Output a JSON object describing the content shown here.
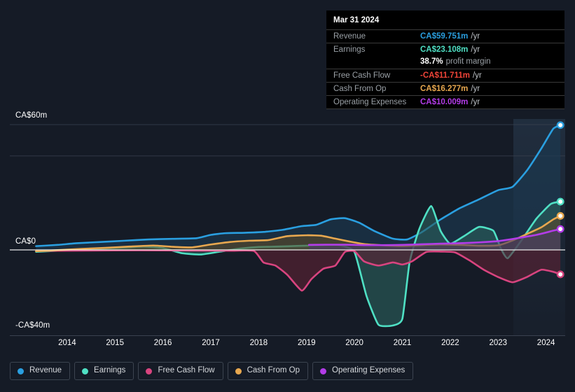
{
  "chart_data": {
    "type": "area",
    "title": "",
    "currency": "CA$",
    "unit": "m",
    "xlabel": "",
    "ylabel": "",
    "ylim": [
      -40,
      60
    ],
    "xlim": [
      2013.3,
      2024.4
    ],
    "grid": true,
    "legend_position": "bottom-left",
    "y_ticks": [
      {
        "value": 60,
        "label": "CA$60m"
      },
      {
        "value": 0,
        "label": "CA$0"
      },
      {
        "value": -40,
        "label": "-CA$40m"
      }
    ],
    "x_ticks": [
      {
        "value": 2014,
        "label": "2014"
      },
      {
        "value": 2015,
        "label": "2015"
      },
      {
        "value": 2016,
        "label": "2016"
      },
      {
        "value": 2017,
        "label": "2017"
      },
      {
        "value": 2018,
        "label": "2018"
      },
      {
        "value": 2019,
        "label": "2019"
      },
      {
        "value": 2020,
        "label": "2020"
      },
      {
        "value": 2021,
        "label": "2021"
      },
      {
        "value": 2022,
        "label": "2022"
      },
      {
        "value": 2023,
        "label": "2023"
      },
      {
        "value": 2024,
        "label": "2024"
      }
    ],
    "forecast_start": 2023.1,
    "series": [
      {
        "name": "Revenue",
        "color": "#2a9fe0",
        "fill": "#1b3a52",
        "x": [
          2013.35,
          2013.8,
          2014.2,
          2014.7,
          2015.2,
          2015.7,
          2016.2,
          2016.7,
          2017.0,
          2017.3,
          2017.7,
          2018.1,
          2018.5,
          2018.9,
          2019.2,
          2019.5,
          2019.8,
          2020.1,
          2020.4,
          2020.8,
          2021.1,
          2021.4,
          2021.8,
          2022.2,
          2022.6,
          2023.0,
          2023.3,
          2023.6,
          2023.9,
          2024.15,
          2024.3
        ],
        "values": [
          1.8,
          2.4,
          3.2,
          3.8,
          4.4,
          5.0,
          5.3,
          5.6,
          7.2,
          8.0,
          8.2,
          8.6,
          9.6,
          11.4,
          12.0,
          14.6,
          15.2,
          13.0,
          9.2,
          5.4,
          5.0,
          8.4,
          14.6,
          20.0,
          24.2,
          28.6,
          30.2,
          38.0,
          48.5,
          58.0,
          59.751
        ]
      },
      {
        "name": "Earnings",
        "color": "#4fe0c4",
        "fill": "#2a5f5c",
        "x": [
          2013.35,
          2013.8,
          2014.2,
          2014.7,
          2015.2,
          2015.6,
          2016.0,
          2016.4,
          2016.8,
          2017.2,
          2017.6,
          2018.0,
          2018.4,
          2018.8,
          2019.1,
          2019.4,
          2019.7,
          2020.0,
          2020.25,
          2020.5,
          2020.8,
          2021.0,
          2021.15,
          2021.35,
          2021.6,
          2021.8,
          2022.0,
          2022.3,
          2022.6,
          2022.9,
          2023.05,
          2023.2,
          2023.5,
          2023.8,
          2024.1,
          2024.3
        ],
        "values": [
          -0.9,
          -0.4,
          0.2,
          0.6,
          1.1,
          1.6,
          0.9,
          -1.6,
          -2.2,
          -0.8,
          0.6,
          1.4,
          1.6,
          1.9,
          2.1,
          2.3,
          2.2,
          -1.0,
          -22.0,
          -35.8,
          -36.2,
          -33.0,
          -6.0,
          9.8,
          21.0,
          9.0,
          3.0,
          6.8,
          11.0,
          9.2,
          1.0,
          -4.0,
          5.0,
          15.0,
          22.0,
          23.108
        ]
      },
      {
        "name": "Free Cash Flow",
        "color": "#d8447f",
        "fill": "#5c2233",
        "x": [
          2013.35,
          2014.5,
          2015.5,
          2016.5,
          2017.4,
          2017.9,
          2018.1,
          2018.35,
          2018.6,
          2018.9,
          2019.1,
          2019.35,
          2019.6,
          2019.8,
          2020.0,
          2020.2,
          2020.5,
          2020.8,
          2021.0,
          2021.2,
          2021.5,
          2021.8,
          2022.1,
          2022.4,
          2022.7,
          2023.0,
          2023.3,
          2023.6,
          2023.9,
          2024.15,
          2024.3
        ],
        "values": [
          -0.5,
          -0.3,
          -0.2,
          -0.3,
          -0.4,
          -0.5,
          -6.0,
          -7.5,
          -12.0,
          -19.5,
          -14.0,
          -9.0,
          -7.5,
          -1.0,
          -0.6,
          -5.5,
          -7.5,
          -6.0,
          -7.0,
          -5.5,
          -1.0,
          -0.8,
          -1.2,
          -5.0,
          -9.5,
          -13.0,
          -15.5,
          -13.0,
          -9.5,
          -10.5,
          -11.711
        ]
      },
      {
        "name": "Cash From Op",
        "color": "#e8a84f",
        "fill": "#5a4a2a",
        "x": [
          2013.35,
          2013.8,
          2014.3,
          2014.8,
          2015.3,
          2015.8,
          2016.2,
          2016.6,
          2017.0,
          2017.4,
          2017.8,
          2018.2,
          2018.6,
          2019.0,
          2019.3,
          2019.6,
          2019.9,
          2020.2,
          2020.6,
          2021.0,
          2021.4,
          2021.8,
          2022.2,
          2022.6,
          2023.0,
          2023.3,
          2023.6,
          2023.9,
          2024.15,
          2024.3
        ],
        "values": [
          -0.6,
          -0.1,
          0.5,
          1.0,
          1.6,
          2.1,
          1.5,
          1.2,
          2.6,
          3.8,
          4.4,
          4.7,
          6.6,
          7.0,
          6.8,
          5.4,
          4.0,
          2.8,
          2.2,
          1.9,
          2.3,
          2.6,
          2.4,
          2.0,
          2.2,
          4.5,
          7.6,
          10.8,
          14.6,
          16.277
        ]
      },
      {
        "name": "Operating Expenses",
        "color": "#b33ce8",
        "fill": "#4a3a66",
        "x": [
          2019.05,
          2019.4,
          2019.8,
          2020.2,
          2020.6,
          2021.0,
          2021.4,
          2021.8,
          2022.2,
          2022.6,
          2023.0,
          2023.4,
          2023.8,
          2024.15,
          2024.3
        ],
        "values": [
          2.4,
          2.5,
          2.5,
          2.3,
          2.3,
          2.4,
          2.7,
          3.0,
          3.2,
          3.6,
          4.2,
          5.6,
          7.2,
          9.2,
          10.009
        ]
      }
    ]
  },
  "tooltip": {
    "date": "Mar 31 2024",
    "unit_suffix": "/yr",
    "rows": [
      {
        "label": "Revenue",
        "value": "CA$59.751m",
        "color": "#2a9fe0"
      },
      {
        "label": "Earnings",
        "value": "CA$23.108m",
        "color": "#4fe0c4"
      },
      {
        "label": "Free Cash Flow",
        "value": "-CA$11.711m",
        "color": "#f04438"
      },
      {
        "label": "Cash From Op",
        "value": "CA$16.277m",
        "color": "#e8a84f"
      },
      {
        "label": "Operating Expenses",
        "value": "CA$10.009m",
        "color": "#b33ce8"
      }
    ],
    "profit_margin": {
      "value": "38.7%",
      "label": "profit margin"
    }
  },
  "legend": {
    "items": [
      {
        "label": "Revenue",
        "color": "#2a9fe0"
      },
      {
        "label": "Earnings",
        "color": "#4fe0c4"
      },
      {
        "label": "Free Cash Flow",
        "color": "#d8447f"
      },
      {
        "label": "Cash From Op",
        "color": "#e8a84f"
      },
      {
        "label": "Operating Expenses",
        "color": "#b33ce8"
      }
    ]
  },
  "theme": {
    "background": "#151b26",
    "grid_color": "#3a4250",
    "zero_line_color": "#ffffff",
    "tooltip_bg": "#000000",
    "text_color": "#ffffff"
  }
}
